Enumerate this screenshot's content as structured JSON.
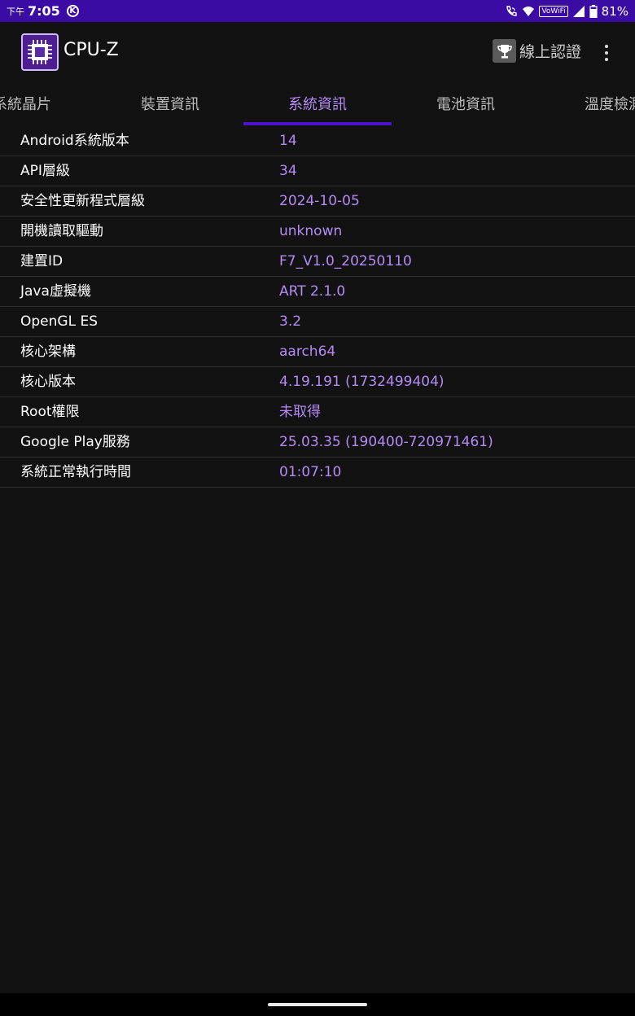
{
  "status_bar": {
    "ampm": "下午",
    "time": "7:05",
    "notification_letter": "K",
    "volte": "VoWiFi",
    "battery": "81%"
  },
  "app_bar": {
    "title": "CPU-Z",
    "certify_label": "線上認證"
  },
  "tabs": [
    {
      "label": "系統晶片",
      "active": false
    },
    {
      "label": "裝置資訊",
      "active": false
    },
    {
      "label": "系統資訊",
      "active": true
    },
    {
      "label": "電池資訊",
      "active": false
    },
    {
      "label": "溫度檢測",
      "active": false
    }
  ],
  "rows": [
    {
      "label": "Android系統版本",
      "value": "14"
    },
    {
      "label": "API層級",
      "value": "34"
    },
    {
      "label": "安全性更新程式層級",
      "value": "2024-10-05"
    },
    {
      "label": "開機讀取驅動",
      "value": "unknown"
    },
    {
      "label": "建置ID",
      "value": "F7_V1.0_20250110"
    },
    {
      "label": "Java虛擬機",
      "value": "ART 2.1.0"
    },
    {
      "label": "OpenGL ES",
      "value": "3.2"
    },
    {
      "label": "核心架構",
      "value": "aarch64"
    },
    {
      "label": "核心版本",
      "value": "4.19.191 (1732499404)"
    },
    {
      "label": "Root權限",
      "value": "未取得"
    },
    {
      "label": "Google Play服務",
      "value": "25.03.35 (190400-720971461)"
    },
    {
      "label": "系統正常執行時間",
      "value": "01:07:10"
    }
  ],
  "colors": {
    "status_bar": "#3a0ca3",
    "accent": "#b48bf5",
    "indicator": "#4b12c9",
    "background": "#121212"
  },
  "icons": [
    "k-circle-icon",
    "wifi-call-icon",
    "wifi-icon",
    "signal-icon",
    "battery-icon",
    "cpu-chip-icon",
    "trophy-icon",
    "more-vert-icon"
  ]
}
